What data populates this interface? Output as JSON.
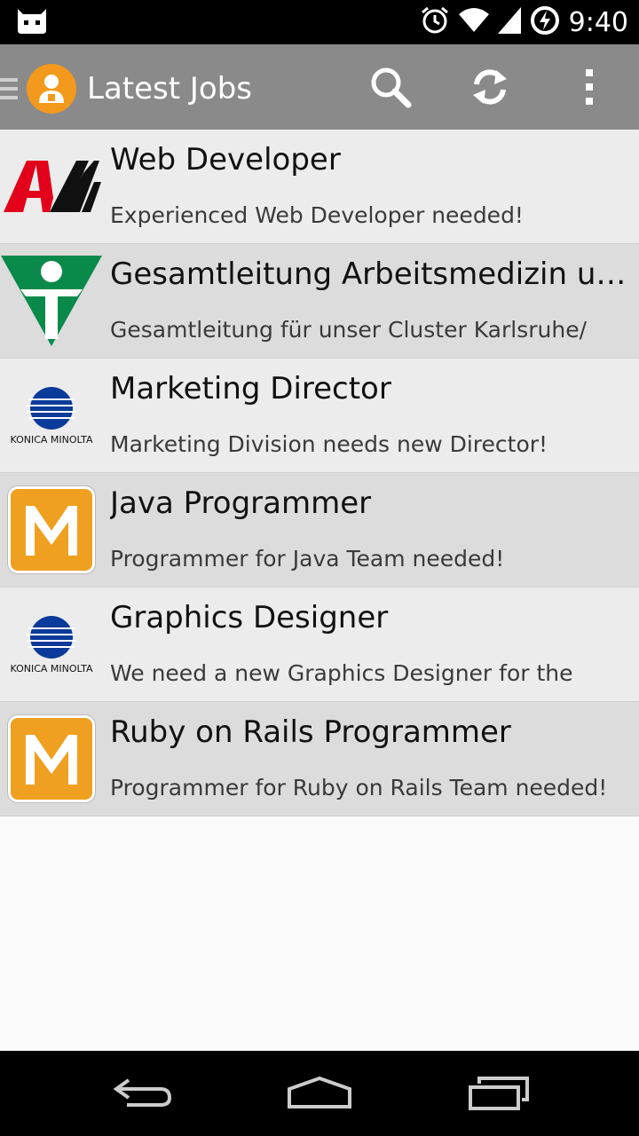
{
  "status_bar": {
    "time": "9:40",
    "icons": [
      "cyanogen-mascot-icon",
      "alarm-icon",
      "wifi-icon",
      "signal-icon",
      "battery-charging-icon"
    ]
  },
  "action_bar": {
    "title": "Latest Jobs",
    "icons": [
      "drawer-indicator-icon",
      "app-avatar-icon",
      "search-icon",
      "refresh-icon",
      "overflow-menu-icon"
    ]
  },
  "jobs": [
    {
      "logo": "AVM",
      "title": "Web Developer",
      "description": "Experienced Web Developer needed!"
    },
    {
      "logo": "arbeitsmedizin-logo",
      "title": "Gesamtleitung Arbeitsmedizin und...",
      "description": "Gesamtleitung für unser Cluster Karlsruhe/"
    },
    {
      "logo": "KONICA MINOLTA",
      "title": "Marketing Director",
      "description": "Marketing Division needs new Director!"
    },
    {
      "logo": "M",
      "title": "Java Programmer",
      "description": "Programmer for Java Team needed!"
    },
    {
      "logo": "KONICA MINOLTA",
      "title": "Graphics Designer",
      "description": "We need a new Graphics Designer for the"
    },
    {
      "logo": "M",
      "title": "Ruby on Rails Programmer",
      "description": "Programmer for Ruby on Rails Team needed!"
    }
  ],
  "nav_bar": {
    "icons": [
      "back-icon",
      "home-icon",
      "recent-apps-icon"
    ]
  },
  "colors": {
    "action_bar": "#8a8a8a",
    "app_icon": "#f39a1d",
    "row_light": "#ececec",
    "row_dark": "#dcdcdc",
    "avm_red": "#e2001a",
    "konica_blue": "#0a3a9a",
    "m_orange": "#f0a020",
    "medizin_green": "#0a8a4a"
  }
}
